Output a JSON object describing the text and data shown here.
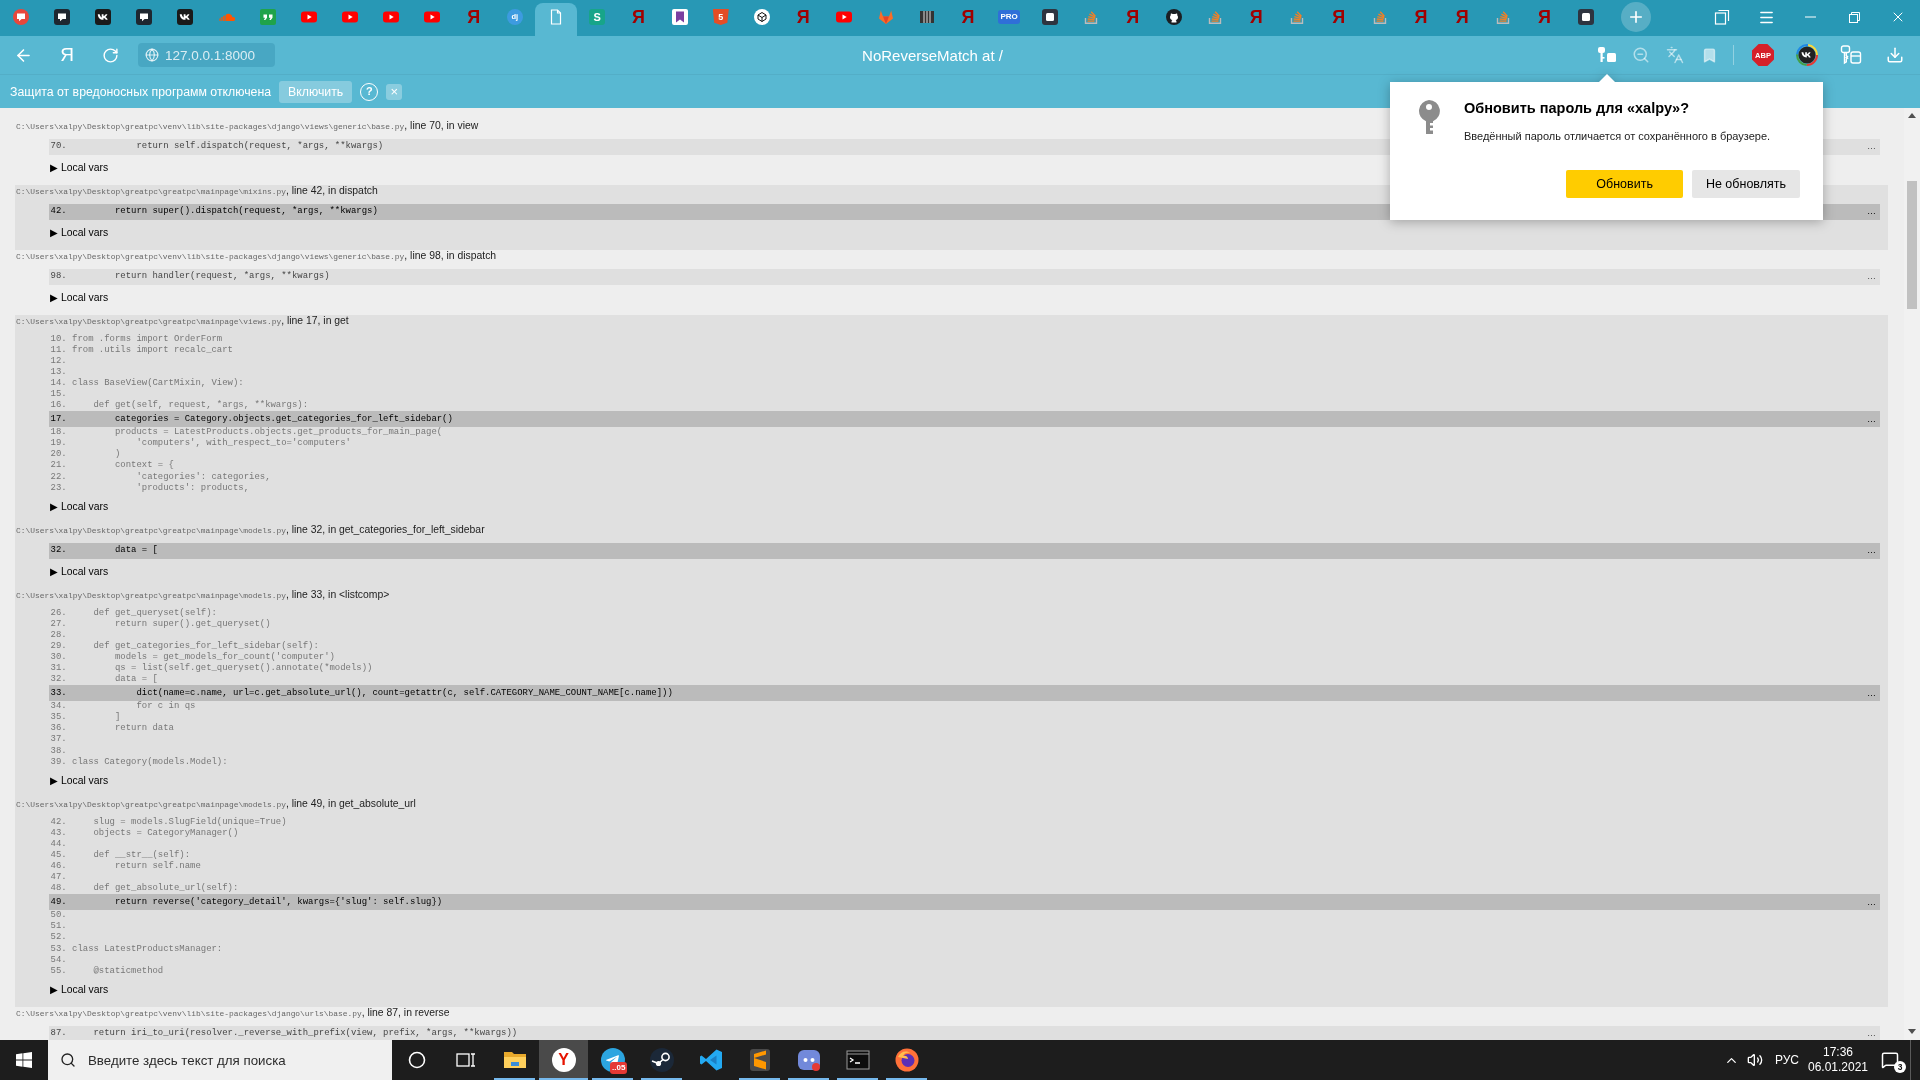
{
  "tabs": [
    {
      "kind": "chat-red",
      "selected": false
    },
    {
      "kind": "chat-dark",
      "selected": false
    },
    {
      "kind": "vk",
      "selected": false
    },
    {
      "kind": "chat-dark",
      "selected": false
    },
    {
      "kind": "vk",
      "selected": false
    },
    {
      "kind": "cloud",
      "selected": false
    },
    {
      "kind": "quote",
      "selected": false
    },
    {
      "kind": "play",
      "selected": false
    },
    {
      "kind": "play",
      "selected": false
    },
    {
      "kind": "play",
      "selected": false
    },
    {
      "kind": "play",
      "selected": false
    },
    {
      "kind": "red-letter",
      "glyph": "Я",
      "selected": false
    },
    {
      "kind": "disc",
      "glyph": "dj",
      "selected": false
    },
    {
      "kind": "page",
      "selected": true
    },
    {
      "kind": "tile",
      "glyph": "S",
      "selected": false
    },
    {
      "kind": "red-letter",
      "glyph": "Я",
      "selected": false
    },
    {
      "kind": "ribbon",
      "selected": false
    },
    {
      "kind": "shield",
      "glyph": "5",
      "selected": false
    },
    {
      "kind": "cube",
      "selected": false
    },
    {
      "kind": "red-letter",
      "glyph": "Я",
      "selected": false
    },
    {
      "kind": "play",
      "selected": false
    },
    {
      "kind": "fox",
      "selected": false
    },
    {
      "kind": "book",
      "selected": false
    },
    {
      "kind": "red-letter",
      "glyph": "Я",
      "selected": false
    },
    {
      "kind": "pro",
      "glyph": "PRO",
      "selected": false
    },
    {
      "kind": "dark-tile",
      "selected": false
    },
    {
      "kind": "stack",
      "selected": false
    },
    {
      "kind": "red-letter",
      "glyph": "Я",
      "selected": false
    },
    {
      "kind": "cat",
      "selected": false
    },
    {
      "kind": "stack",
      "selected": false
    },
    {
      "kind": "red-letter",
      "glyph": "Я",
      "selected": false
    },
    {
      "kind": "stack",
      "selected": false
    },
    {
      "kind": "red-letter",
      "glyph": "Я",
      "selected": false
    },
    {
      "kind": "stack",
      "selected": false
    },
    {
      "kind": "red-letter",
      "glyph": "Я",
      "selected": false
    },
    {
      "kind": "red-letter",
      "glyph": "Я",
      "selected": false
    },
    {
      "kind": "stack",
      "selected": false
    },
    {
      "kind": "red-letter",
      "glyph": "Я",
      "selected": false
    },
    {
      "kind": "dark-tile",
      "selected": false
    }
  ],
  "toolbar": {
    "home_glyph": "Я",
    "address": "127.0.0.1:8000",
    "title": "NoReverseMatch at /",
    "page_icons": [
      {
        "kind": "password",
        "active": true
      },
      {
        "kind": "zoom",
        "active": false
      },
      {
        "kind": "translate",
        "active": false
      },
      {
        "kind": "bookmark",
        "active": false
      }
    ],
    "extensions": [
      {
        "kind": "abp",
        "glyph": "ABP"
      },
      {
        "kind": "vk"
      },
      {
        "kind": "passwords"
      },
      {
        "kind": "download"
      }
    ]
  },
  "protection_bar": {
    "message": "Защита от вредоносных программ отключена",
    "button": "Включить",
    "help": "?",
    "close": "×"
  },
  "password_popup": {
    "title": "Обновить пароль для «xalpy»?",
    "text": "Введённый пароль отличается от сохранённого в браузере.",
    "buttons": [
      {
        "label": "Обновить",
        "primary": true
      },
      {
        "label": "Не обновлять",
        "primary": false
      }
    ]
  },
  "traceback": {
    "frames": [
      {
        "kind": "django",
        "file": "C:\\Users\\xalpy\\Desktop\\greatpc\\venv\\lib\\site-packages\\django\\views\\generic\\base.py",
        "where": ", line 70, in view",
        "context_line": {
          "number": "70.",
          "code": "            return self.dispatch(request, *args, **kwargs)",
          "ellipsis": "…"
        },
        "local_vars": "▶ Local vars"
      },
      {
        "kind": "user",
        "file": "C:\\Users\\xalpy\\Desktop\\greatpc\\greatpc\\mainpage\\mixins.py",
        "where": ", line 42, in dispatch",
        "context_line": {
          "number": "42.",
          "code": "        return super().dispatch(request, *args, **kwargs)",
          "ellipsis": "…"
        },
        "local_vars": "▶ Local vars"
      },
      {
        "kind": "django",
        "file": "C:\\Users\\xalpy\\Desktop\\greatpc\\venv\\lib\\site-packages\\django\\views\\generic\\base.py",
        "where": ", line 98, in dispatch",
        "context_line": {
          "number": "98.",
          "code": "        return handler(request, *args, **kwargs)",
          "ellipsis": "…"
        },
        "local_vars": "▶ Local vars"
      },
      {
        "kind": "user",
        "file": "C:\\Users\\xalpy\\Desktop\\greatpc\\greatpc\\mainpage\\views.py",
        "where": ", line 17, in get",
        "pre_context": [
          {
            "number": "10.",
            "code": "from .forms import OrderForm"
          },
          {
            "number": "11.",
            "code": "from .utils import recalc_cart"
          },
          {
            "number": "12."
          },
          {
            "number": "13."
          },
          {
            "number": "14.",
            "code": "class BaseView(CartMixin, View):"
          },
          {
            "number": "15."
          },
          {
            "number": "16.",
            "code": "    def get(self, request, *args, **kwargs):"
          }
        ],
        "context_line": {
          "number": "17.",
          "code": "        categories = Category.objects.get_categories_for_left_sidebar()",
          "ellipsis": "…"
        },
        "post_context": [
          {
            "number": "18.",
            "code": "        products = LatestProducts.objects.get_products_for_main_page("
          },
          {
            "number": "19.",
            "code": "            'computers', with_respect_to='computers'"
          },
          {
            "number": "20.",
            "code": "        )"
          },
          {
            "number": "21.",
            "code": "        context = {"
          },
          {
            "number": "22.",
            "code": "            'categories': categories,"
          },
          {
            "number": "23.",
            "code": "            'products': products,"
          }
        ],
        "local_vars": "▶ Local vars"
      },
      {
        "kind": "user",
        "file": "C:\\Users\\xalpy\\Desktop\\greatpc\\greatpc\\mainpage\\models.py",
        "where": ", line 32, in get_categories_for_left_sidebar",
        "context_line": {
          "number": "32.",
          "code": "        data = [",
          "ellipsis": "…"
        },
        "local_vars": "▶ Local vars"
      },
      {
        "kind": "user",
        "file": "C:\\Users\\xalpy\\Desktop\\greatpc\\greatpc\\mainpage\\models.py",
        "where": ", line 33, in <listcomp>",
        "pre_context": [
          {
            "number": "26.",
            "code": "    def get_queryset(self):"
          },
          {
            "number": "27.",
            "code": "        return super().get_queryset()"
          },
          {
            "number": "28."
          },
          {
            "number": "29.",
            "code": "    def get_categories_for_left_sidebar(self):"
          },
          {
            "number": "30.",
            "code": "        models = get_models_for_count('computer')"
          },
          {
            "number": "31.",
            "code": "        qs = list(self.get_queryset().annotate(*models))"
          },
          {
            "number": "32.",
            "code": "        data = ["
          }
        ],
        "context_line": {
          "number": "33.",
          "code": "            dict(name=c.name, url=c.get_absolute_url(), count=getattr(c, self.CATEGORY_NAME_COUNT_NAME[c.name]))",
          "ellipsis": "…"
        },
        "post_context": [
          {
            "number": "34.",
            "code": "            for c in qs"
          },
          {
            "number": "35.",
            "code": "        ]"
          },
          {
            "number": "36.",
            "code": "        return data"
          },
          {
            "number": "37."
          },
          {
            "number": "38."
          },
          {
            "number": "39.",
            "code": "class Category(models.Model):"
          }
        ],
        "local_vars": "▶ Local vars"
      },
      {
        "kind": "user",
        "file": "C:\\Users\\xalpy\\Desktop\\greatpc\\greatpc\\mainpage\\models.py",
        "where": ", line 49, in get_absolute_url",
        "pre_context": [
          {
            "number": "42.",
            "code": "    slug = models.SlugField(unique=True)"
          },
          {
            "number": "43.",
            "code": "    objects = CategoryManager()"
          },
          {
            "number": "44."
          },
          {
            "number": "45.",
            "code": "    def __str__(self):"
          },
          {
            "number": "46.",
            "code": "        return self.name"
          },
          {
            "number": "47."
          },
          {
            "number": "48.",
            "code": "    def get_absolute_url(self):"
          }
        ],
        "context_line": {
          "number": "49.",
          "code": "        return reverse('category_detail', kwargs={'slug': self.slug})",
          "ellipsis": "…"
        },
        "post_context": [
          {
            "number": "50."
          },
          {
            "number": "51."
          },
          {
            "number": "52."
          },
          {
            "number": "53.",
            "code": "class LatestProductsManager:"
          },
          {
            "number": "54."
          },
          {
            "number": "55.",
            "code": "    @staticmethod"
          }
        ],
        "local_vars": "▶ Local vars"
      },
      {
        "kind": "django",
        "file": "C:\\Users\\xalpy\\Desktop\\greatpc\\venv\\lib\\site-packages\\django\\urls\\base.py",
        "where": ", line 87, in reverse",
        "context_line": {
          "number": "87.",
          "code": "    return iri_to_uri(resolver._reverse_with_prefix(view, prefix, *args, **kwargs))",
          "ellipsis": "…"
        }
      }
    ]
  },
  "taskbar": {
    "search_placeholder": "Введите здесь текст для поиска",
    "apps": [
      {
        "kind": "ring",
        "selected": false,
        "running": false
      },
      {
        "kind": "task-view",
        "selected": false,
        "running": false
      },
      {
        "kind": "folder",
        "selected": false,
        "running": true
      },
      {
        "kind": "browser",
        "glyph": "Y",
        "selected": true,
        "running": true
      },
      {
        "kind": "plane",
        "badge": "..05",
        "selected": false,
        "running": true
      },
      {
        "kind": "steam",
        "selected": false,
        "running": true
      },
      {
        "kind": "ribbon",
        "selected": false,
        "running": false
      },
      {
        "kind": "sublime",
        "selected": false,
        "running": true
      },
      {
        "kind": "discord",
        "selected": false,
        "running": true
      },
      {
        "kind": "terminal",
        "selected": false,
        "running": true
      },
      {
        "kind": "firefox",
        "selected": false,
        "running": true
      }
    ],
    "language": "РУС",
    "time": "17:36",
    "date": "06.01.2021",
    "notifications": "3"
  }
}
